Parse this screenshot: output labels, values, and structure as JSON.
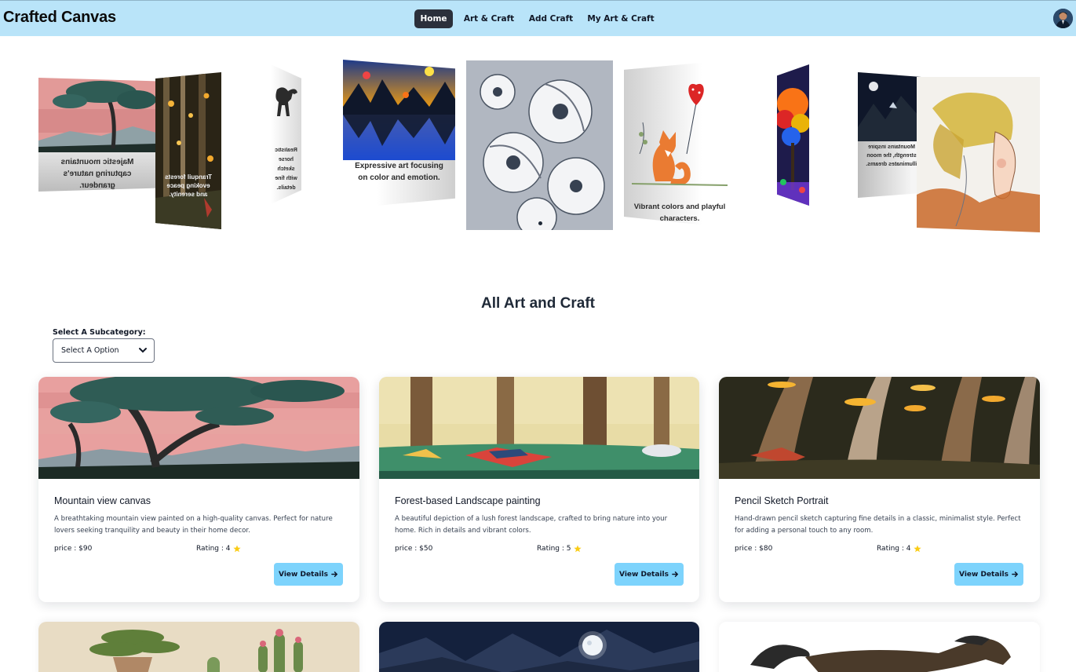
{
  "navbar": {
    "brand": "Crafted Canvas",
    "links": [
      {
        "label": "Home",
        "active": true
      },
      {
        "label": "Art & Craft",
        "active": false
      },
      {
        "label": "Add Craft",
        "active": false
      },
      {
        "label": "My Art & Craft",
        "active": false
      }
    ]
  },
  "carousel": {
    "captions": {
      "mountain": "Majestic mountains capturing nature's grandeur.",
      "forest": "Tranquil forests evoking peace and serenity.",
      "horse": "Realistic horse sketch with fine details.",
      "expressive": "Expressive art focusing on color and emotion.",
      "fox": "Vibrant colors and playful characters.",
      "moon": "Mountains inspire strength, the moon illuminates dreams."
    }
  },
  "section": {
    "title": "All Art and Craft",
    "filter_label": "Select A Subcategory:",
    "filter_value": "Select A Option"
  },
  "cards": [
    {
      "title": "Mountain view canvas",
      "description": "A breathtaking mountain view painted on a high-quality canvas. Perfect for nature lovers seeking tranquility and beauty in their home decor.",
      "price": "price : $90",
      "rating": "Rating : 4",
      "button": "View Details"
    },
    {
      "title": "Forest-based Landscape painting",
      "description": "A beautiful depiction of a lush forest landscape, crafted to bring nature into your home. Rich in details and vibrant colors.",
      "price": "price : $50",
      "rating": "Rating : 5",
      "button": "View Details"
    },
    {
      "title": "Pencil Sketch Portrait",
      "description": "Hand-drawn pencil sketch capturing fine details in a classic, minimalist style. Perfect for adding a personal touch to any room.",
      "price": "price : $80",
      "rating": "Rating : 4",
      "button": "View Details"
    }
  ],
  "colors": {
    "navbar_bg": "#b9e4f9",
    "active_nav": "#2b303b",
    "button_bg": "#7dd3fc",
    "star": "#facc15"
  }
}
